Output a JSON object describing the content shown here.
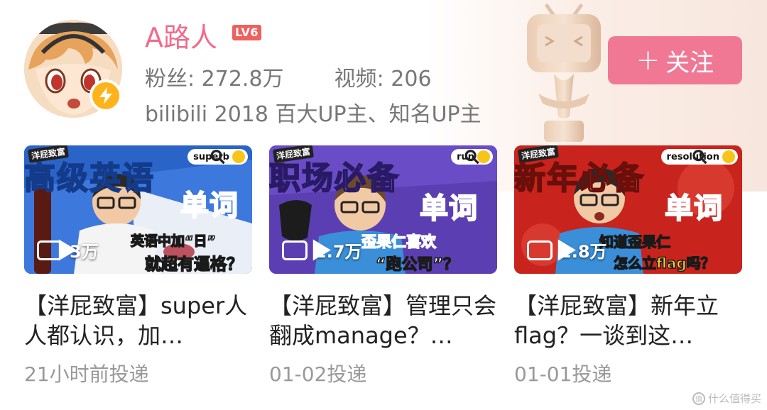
{
  "profile": {
    "name": "A路人",
    "level": "LV6",
    "fans_label": "粉丝:",
    "fans_value": "272.8万",
    "videos_label": "视频:",
    "videos_value": "206",
    "description": "bilibili 2018 百大UP主、知名UP主",
    "follow_label": "关注",
    "avatar_icon": "anime-avatar",
    "badge_icon": "lightning-icon"
  },
  "colors": {
    "name": "#f06b8d",
    "follow_bg": "#f07894",
    "level_bg": "#f0605e",
    "badge": "#ffb31a"
  },
  "videos": [
    {
      "series": "洋屁致富",
      "keyword": "superb",
      "thumb_top": "高级英语",
      "thumb_big": "单词",
      "thumb_sub1": "英语中加“日”",
      "thumb_sub2": "就超有逼格？",
      "views": "3万",
      "title": "【洋屁致富】super人人都认识，加…",
      "time": "21小时前投递",
      "bg": "#2a64c8"
    },
    {
      "series": "洋屁致富",
      "keyword": "run",
      "thumb_top": "职场必备",
      "thumb_big": "单词",
      "thumb_sub1": "歪果仁喜欢",
      "thumb_sub2": "“跑公司”？",
      "views": "2.7万",
      "title": "【洋屁致富】管理只会翻成manage？…",
      "time": "01-02投递",
      "bg": "#5b3fb2"
    },
    {
      "series": "洋屁致富",
      "keyword": "resolution",
      "thumb_top": "新年必备",
      "thumb_big": "单词",
      "thumb_sub1": "知道歪果仁",
      "thumb_sub2": "怎么立flag吗？",
      "views": "2.8万",
      "title": "【洋屁致富】新年立flag？一谈到这…",
      "time": "01-01投递",
      "bg": "#c8231c"
    }
  ],
  "watermark": {
    "text": "什么值得买",
    "logo": "值"
  }
}
